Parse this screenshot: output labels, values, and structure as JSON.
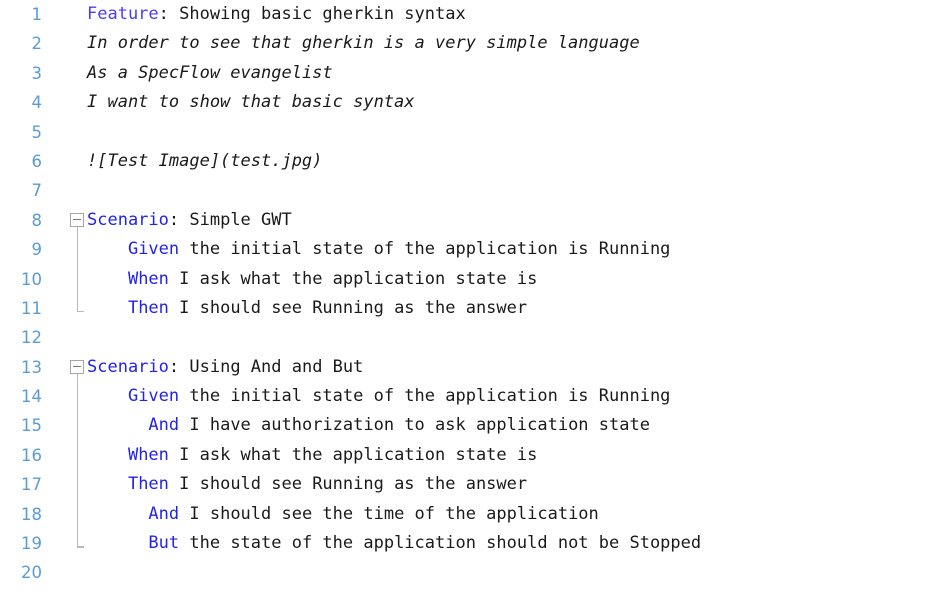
{
  "editor": {
    "type": "gherkin-feature-file",
    "background_color": "#ffffff",
    "keyword_color": "#2323e8",
    "feature_keyword_color": "#4a3ef0",
    "text_color": "#1a1a1a",
    "line_number_color": "#5b9bd5",
    "fold_marker_color": "#a6a6a6",
    "total_lines": 20
  },
  "lines": [
    {
      "number": "1",
      "indent": 0,
      "keyword": "Feature",
      "separator": ":",
      "text": " Showing basic gherkin syntax",
      "style": "feature",
      "fold": "open"
    },
    {
      "number": "2",
      "indent": 0,
      "keyword": "",
      "separator": "",
      "text": "In order to see that gherkin is a very simple language",
      "style": "description",
      "fold": "none"
    },
    {
      "number": "3",
      "indent": 0,
      "keyword": "",
      "separator": "",
      "text": "As a SpecFlow evangelist",
      "style": "description",
      "fold": "none"
    },
    {
      "number": "4",
      "indent": 0,
      "keyword": "",
      "separator": "",
      "text": "I want to show that basic syntax",
      "style": "description",
      "fold": "none"
    },
    {
      "number": "5",
      "indent": 0,
      "keyword": "",
      "separator": "",
      "text": "",
      "style": "blank",
      "fold": "none"
    },
    {
      "number": "6",
      "indent": 0,
      "keyword": "",
      "separator": "",
      "text": "![Test Image](test.jpg)",
      "style": "description",
      "fold": "none"
    },
    {
      "number": "7",
      "indent": 0,
      "keyword": "",
      "separator": "",
      "text": "",
      "style": "blank",
      "fold": "none"
    },
    {
      "number": "8",
      "indent": 0,
      "keyword": "Scenario",
      "separator": ":",
      "text": " Simple GWT",
      "style": "scenario",
      "fold": "collapse-start"
    },
    {
      "number": "9",
      "indent": 4,
      "keyword": "Given",
      "separator": "",
      "text": " the initial state of the application is Running",
      "style": "step",
      "fold": "inside"
    },
    {
      "number": "10",
      "indent": 4,
      "keyword": "When",
      "separator": "",
      "text": " I ask what the application state is",
      "style": "step",
      "fold": "inside"
    },
    {
      "number": "11",
      "indent": 4,
      "keyword": "Then",
      "separator": "",
      "text": " I should see Running as the answer",
      "style": "step",
      "fold": "collapse-end"
    },
    {
      "number": "12",
      "indent": 0,
      "keyword": "",
      "separator": "",
      "text": "",
      "style": "blank",
      "fold": "none"
    },
    {
      "number": "13",
      "indent": 0,
      "keyword": "Scenario",
      "separator": ":",
      "text": " Using And and But",
      "style": "scenario",
      "fold": "collapse-start"
    },
    {
      "number": "14",
      "indent": 4,
      "keyword": "Given",
      "separator": "",
      "text": " the initial state of the application is Running",
      "style": "step",
      "fold": "inside"
    },
    {
      "number": "15",
      "indent": 6,
      "keyword": "And",
      "separator": "",
      "text": " I have authorization to ask application state",
      "style": "step",
      "fold": "inside"
    },
    {
      "number": "16",
      "indent": 4,
      "keyword": "When",
      "separator": "",
      "text": " I ask what the application state is",
      "style": "step",
      "fold": "inside"
    },
    {
      "number": "17",
      "indent": 4,
      "keyword": "Then",
      "separator": "",
      "text": " I should see Running as the answer",
      "style": "step",
      "fold": "inside"
    },
    {
      "number": "18",
      "indent": 6,
      "keyword": "And",
      "separator": "",
      "text": " I should see the time of the application",
      "style": "step",
      "fold": "inside"
    },
    {
      "number": "19",
      "indent": 6,
      "keyword": "But",
      "separator": "",
      "text": " the state of the application should not be Stopped",
      "style": "step",
      "fold": "collapse-end"
    },
    {
      "number": "20",
      "indent": 0,
      "keyword": "",
      "separator": "",
      "text": "",
      "style": "blank",
      "fold": "none"
    }
  ]
}
